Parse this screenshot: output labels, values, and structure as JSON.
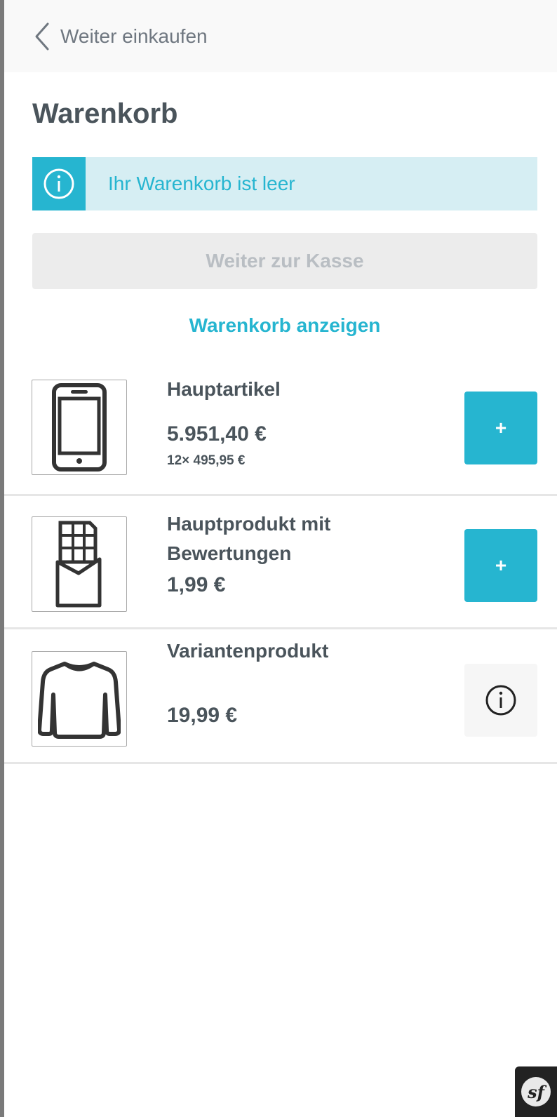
{
  "header": {
    "back_label": "Weiter einkaufen"
  },
  "cart": {
    "title": "Warenkorb",
    "alert_text": "Ihr Warenkorb ist leer",
    "checkout_label": "Weiter zur Kasse",
    "show_cart_label": "Warenkorb anzeigen"
  },
  "products": [
    {
      "name": "Hauptartikel",
      "price": "5.951,40 €",
      "unit_price": "12× 495,95 €",
      "image": "phone-icon",
      "action": "+"
    },
    {
      "name": "Hauptprodukt mit Bewertungen",
      "price": "1,99 €",
      "image": "chocolate-icon",
      "action": "+"
    },
    {
      "name": "Variantenprodukt",
      "price": "19,99 €",
      "image": "shirt-icon",
      "action": "info"
    }
  ],
  "colors": {
    "accent": "#26b5d0",
    "alert_bg": "#d6eef3",
    "text": "#4a545b",
    "muted": "#b9bec3"
  }
}
